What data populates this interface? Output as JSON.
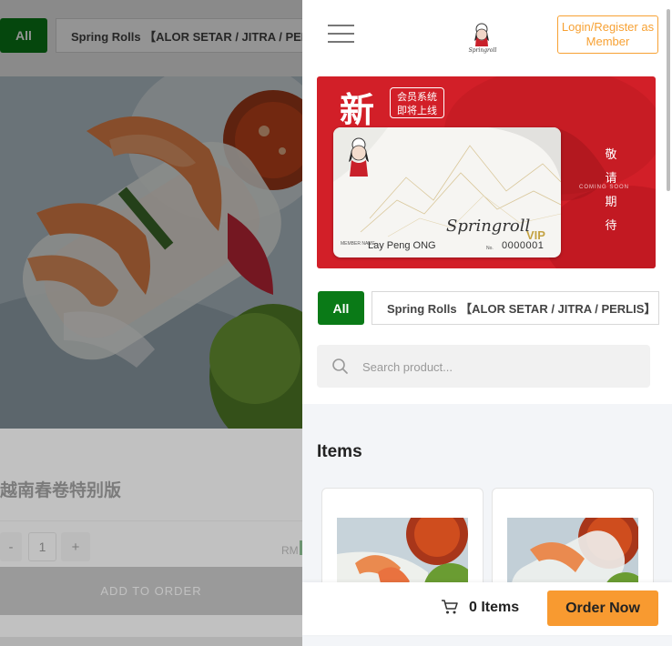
{
  "left_pane": {
    "category_all": "All",
    "category_tab": "Spring Rolls 【ALOR SETAR / JITRA / PERLIS】",
    "product_name": "越南春卷特别版",
    "quantity_minus": "-",
    "quantity_value": "1",
    "quantity_plus": "+",
    "price_prefix": "RM",
    "add_to_order": "ADD TO ORDER"
  },
  "header": {
    "menu_icon": "hamburger-menu-icon",
    "logo_icon": "springroll-logo-icon",
    "login_label": "Login/Register as Member"
  },
  "banner": {
    "new_char": "新",
    "badge_text": "会员系统 即将上线",
    "vertical_text": "敬 请 期 待",
    "coming_soon": "COMING SOON",
    "card": {
      "brand_script": "Springroll",
      "vip": "VIP",
      "member_label": "MEMBER NAME",
      "member_name": "Lay Peng ONG",
      "number_label": "No.",
      "member_number": "0000001"
    }
  },
  "categories": {
    "all": "All",
    "spring_rolls": "Spring Rolls 【ALOR SETAR / JITRA / PERLIS】"
  },
  "search": {
    "icon": "search-icon",
    "placeholder": "Search product..."
  },
  "items_section": {
    "title": "Items"
  },
  "cart": {
    "icon": "cart-icon",
    "items_count": "0 Items",
    "order_now": "Order Now"
  },
  "colors": {
    "brand_green": "#0a7a17",
    "banner_red": "#d21f28",
    "accent_orange": "#f89a30",
    "login_orange": "#f7a133"
  }
}
